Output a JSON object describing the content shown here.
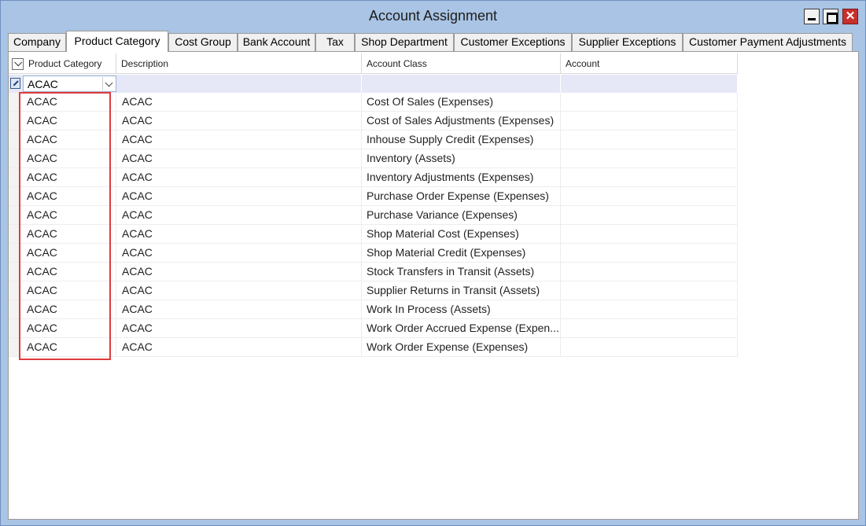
{
  "window": {
    "title": "Account Assignment",
    "close_glyph": "✕"
  },
  "tabs": [
    {
      "label": "Company"
    },
    {
      "label": "Product Category"
    },
    {
      "label": "Cost Group"
    },
    {
      "label": "Bank Account"
    },
    {
      "label": "Tax"
    },
    {
      "label": "Shop Department"
    },
    {
      "label": "Customer Exceptions"
    },
    {
      "label": "Supplier Exceptions"
    },
    {
      "label": "Customer Payment Adjustments"
    }
  ],
  "active_tab": "Product Category",
  "grid": {
    "columns": [
      {
        "label": "Product Category"
      },
      {
        "label": "Description"
      },
      {
        "label": "Account Class"
      },
      {
        "label": "Account"
      }
    ],
    "filter": {
      "product_category_value": "ACAC"
    },
    "rows": [
      {
        "product_category": "ACAC",
        "description": "ACAC",
        "account_class": "Cost Of Sales (Expenses)",
        "account": ""
      },
      {
        "product_category": "ACAC",
        "description": "ACAC",
        "account_class": "Cost of Sales Adjustments (Expenses)",
        "account": ""
      },
      {
        "product_category": "ACAC",
        "description": "ACAC",
        "account_class": "Inhouse Supply Credit (Expenses)",
        "account": ""
      },
      {
        "product_category": "ACAC",
        "description": "ACAC",
        "account_class": "Inventory (Assets)",
        "account": ""
      },
      {
        "product_category": "ACAC",
        "description": "ACAC",
        "account_class": "Inventory Adjustments (Expenses)",
        "account": ""
      },
      {
        "product_category": "ACAC",
        "description": "ACAC",
        "account_class": "Purchase Order Expense (Expenses)",
        "account": ""
      },
      {
        "product_category": "ACAC",
        "description": "ACAC",
        "account_class": "Purchase Variance (Expenses)",
        "account": ""
      },
      {
        "product_category": "ACAC",
        "description": "ACAC",
        "account_class": "Shop Material Cost (Expenses)",
        "account": ""
      },
      {
        "product_category": "ACAC",
        "description": "ACAC",
        "account_class": "Shop Material Credit (Expenses)",
        "account": ""
      },
      {
        "product_category": "ACAC",
        "description": "ACAC",
        "account_class": "Stock Transfers in Transit (Assets)",
        "account": ""
      },
      {
        "product_category": "ACAC",
        "description": "ACAC",
        "account_class": "Supplier Returns in Transit (Assets)",
        "account": ""
      },
      {
        "product_category": "ACAC",
        "description": "ACAC",
        "account_class": "Work In Process (Assets)",
        "account": ""
      },
      {
        "product_category": "ACAC",
        "description": "ACAC",
        "account_class": "Work Order Accrued Expense (Expen...",
        "account": ""
      },
      {
        "product_category": "ACAC",
        "description": "ACAC",
        "account_class": "Work Order Expense (Expenses)",
        "account": ""
      }
    ]
  },
  "colors": {
    "highlight": "#e03c3c",
    "window_bg": "#a9c4e4",
    "filter_row_bg": "#e6e8f7"
  }
}
